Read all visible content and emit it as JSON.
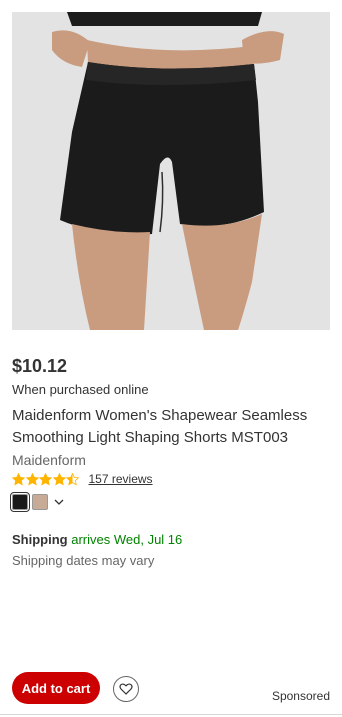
{
  "product": {
    "price": "$10.12",
    "price_note": "When purchased online",
    "title": "Maidenform Women's Shapewear Seamless Smoothing Light Shaping Shorts MST003",
    "brand": "Maidenform",
    "rating": {
      "stars": 4.5,
      "max": 5,
      "reviews_label": "157 reviews"
    },
    "swatches": [
      {
        "name": "black-swatch",
        "color": "#1a1a1a",
        "selected": true
      },
      {
        "name": "nude-swatch",
        "color": "#c8ab96",
        "selected": false
      }
    ],
    "swatch_more_icon": "chevron-down-icon",
    "image_icon": "product-photo"
  },
  "shipping": {
    "label": "Shipping",
    "date": "arrives Wed, Jul 16",
    "note": "Shipping dates may vary"
  },
  "actions": {
    "add_to_cart": "Add to cart",
    "favorite_icon": "heart-icon"
  },
  "sponsored": "Sponsored",
  "colors": {
    "accent": "#cc0000",
    "shipping_green": "#008300",
    "star": "#ffb400"
  }
}
